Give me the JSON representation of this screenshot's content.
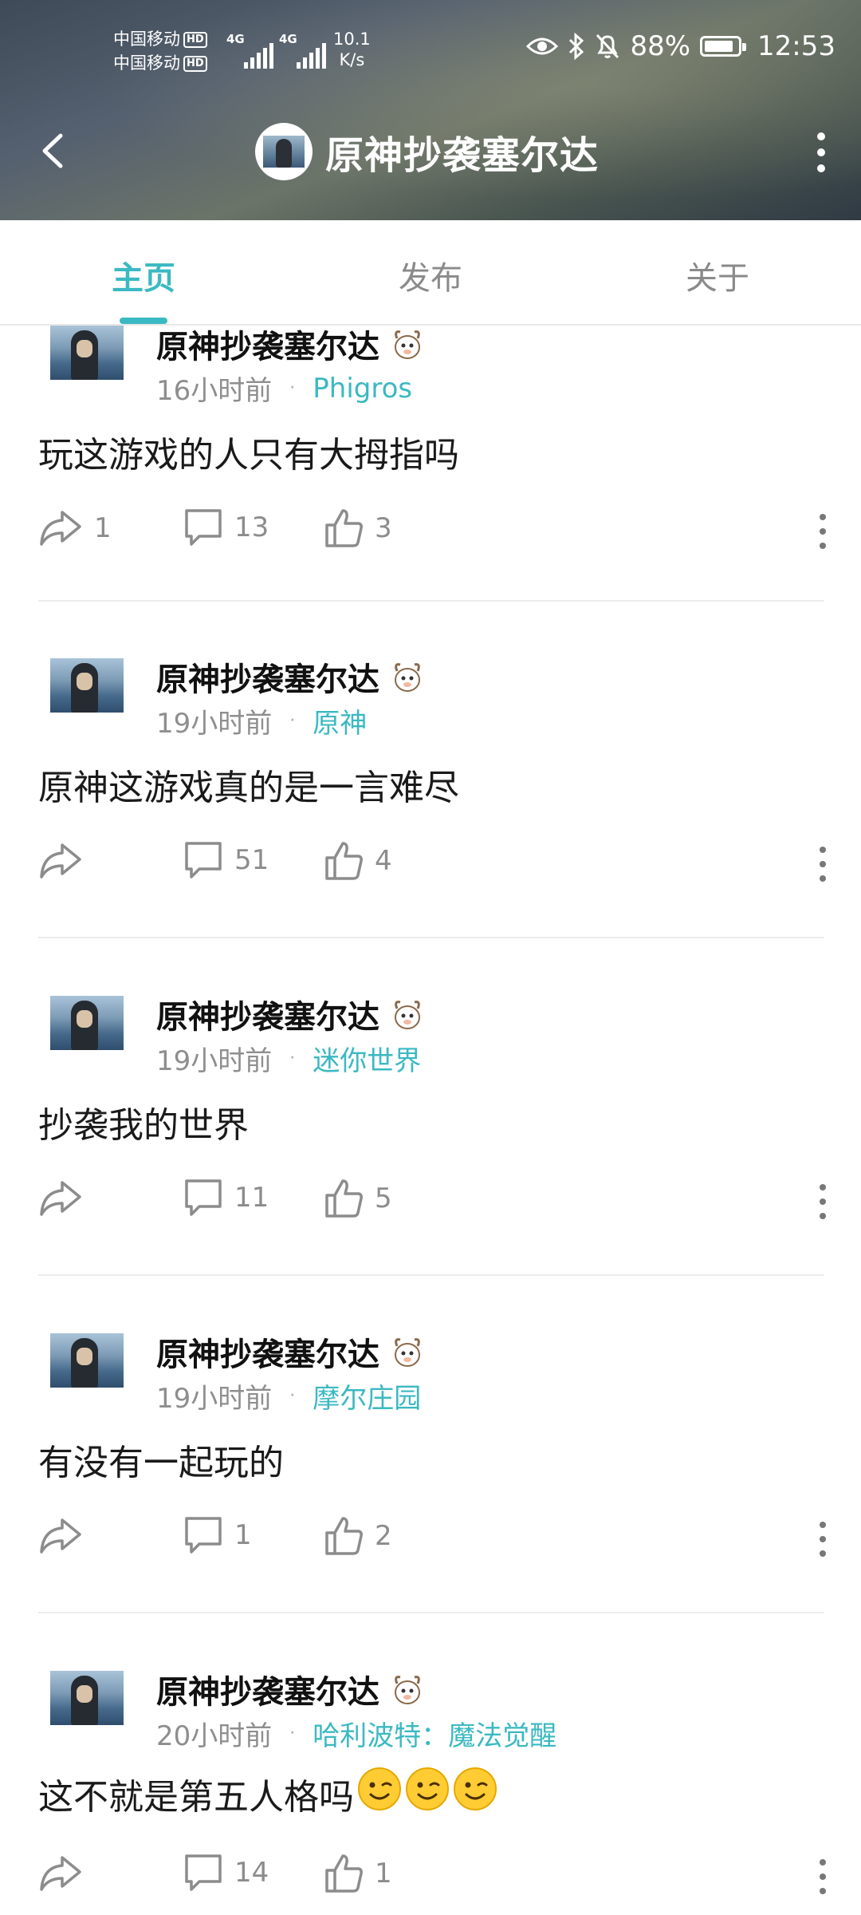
{
  "status_bar": {
    "carrier1": "中国移动",
    "carrier2": "中国移动",
    "hd_label": "HD",
    "net1": "4G",
    "net2": "4G",
    "speed_value": "10.1",
    "speed_unit": "K/s",
    "battery_percent": "88%",
    "battery_level": 0.88,
    "time": "12:53"
  },
  "app_bar": {
    "title": "原神抄袭塞尔达"
  },
  "tabs": [
    {
      "label": "主页",
      "active": true
    },
    {
      "label": "发布",
      "active": false
    },
    {
      "label": "关于",
      "active": false
    }
  ],
  "posts": [
    {
      "username": "原神抄袭塞尔达",
      "time": "16小时前",
      "topic": "Phigros",
      "text": "玩这游戏的人只有大拇指吗",
      "shares": "1",
      "comments": "13",
      "likes": "3"
    },
    {
      "username": "原神抄袭塞尔达",
      "time": "19小时前",
      "topic": "原神",
      "text": "原神这游戏真的是一言难尽",
      "shares": "",
      "comments": "51",
      "likes": "4"
    },
    {
      "username": "原神抄袭塞尔达",
      "time": "19小时前",
      "topic": "迷你世界",
      "text": "抄袭我的世界",
      "shares": "",
      "comments": "11",
      "likes": "5"
    },
    {
      "username": "原神抄袭塞尔达",
      "time": "19小时前",
      "topic": "摩尔庄园",
      "text": "有没有一起玩的",
      "shares": "",
      "comments": "1",
      "likes": "2"
    },
    {
      "username": "原神抄袭塞尔达",
      "time": "20小时前",
      "topic": "哈利波特：魔法觉醒",
      "text": "这不就是第五人格吗",
      "emoji_count": 3,
      "shares": "",
      "comments": "14",
      "likes": "1"
    }
  ],
  "icons": {
    "share": "share-icon",
    "comment": "comment-icon",
    "like": "like-icon",
    "more": "more-icon",
    "back": "back-icon",
    "badge": "goat-badge-icon",
    "emoji": "wink-emoji-icon"
  },
  "colors": {
    "accent": "#3bb9c2",
    "meta_text": "#8e8e8e",
    "divider": "#ececec"
  }
}
